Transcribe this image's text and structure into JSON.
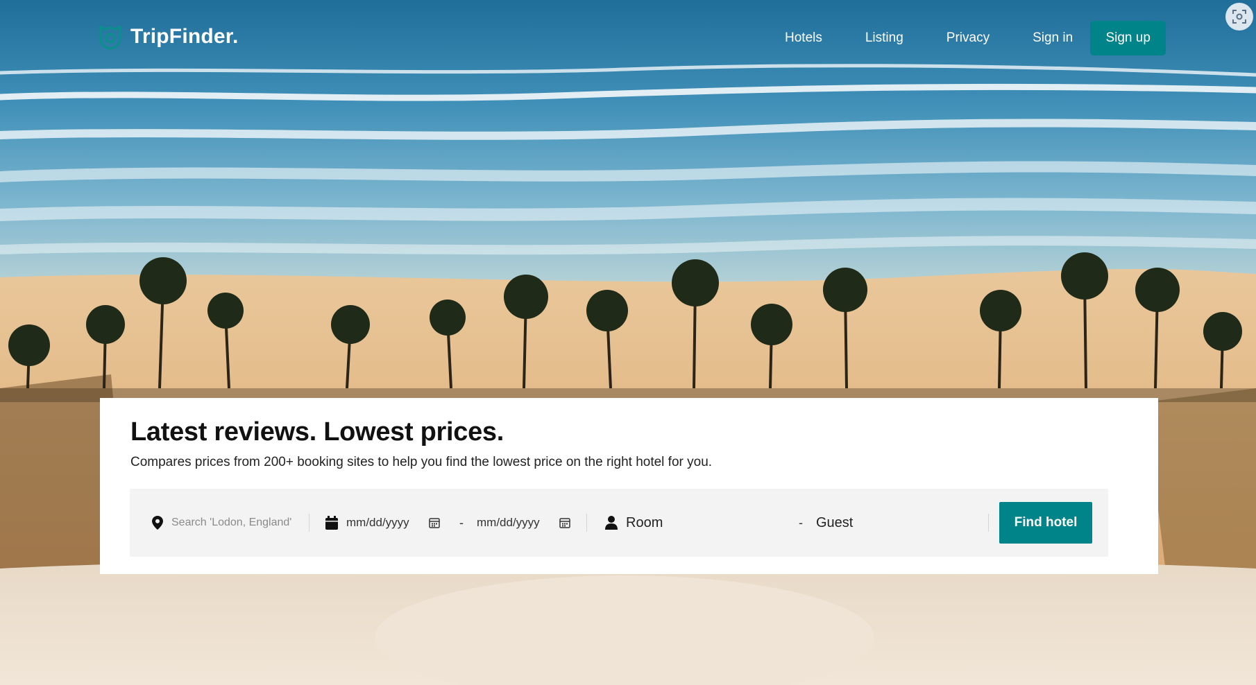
{
  "brand": {
    "name": "TripFinder.",
    "accent": "#008489"
  },
  "nav": {
    "items": [
      {
        "label": "Hotels"
      },
      {
        "label": "Listing"
      },
      {
        "label": "Privacy"
      },
      {
        "label": "Sign in"
      }
    ],
    "signup_label": "Sign up"
  },
  "hero": {
    "title": "Latest reviews. Lowest prices.",
    "subtitle": "Compares prices from 200+ booking sites to help you find the lowest price on the right hotel for you."
  },
  "search": {
    "location_placeholder": "Search 'Lodon, England'",
    "checkin_placeholder": "mm/dd/yyyy",
    "checkout_placeholder": "mm/dd/yyyy",
    "date_separator": "-",
    "room_label": "Room",
    "guest_separator": "-",
    "guest_label": "Guest",
    "submit_label": "Find hotel"
  },
  "icons": {
    "logo": "tripfinder-logo-icon",
    "location": "map-pin-icon",
    "date": "calendar-icon",
    "date_picker": "calendar-small-icon",
    "guests": "user-icon",
    "capture": "screenshot-capture-icon"
  }
}
